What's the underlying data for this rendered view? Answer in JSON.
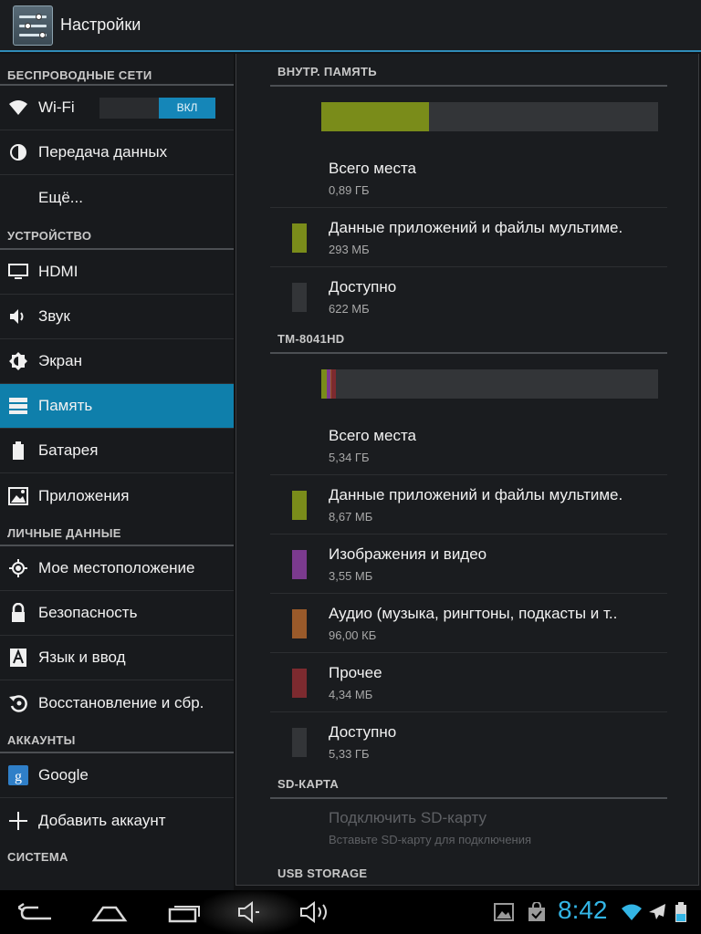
{
  "app": {
    "title": "Настройки"
  },
  "sidebar": {
    "sections": [
      {
        "header": "БЕСПРОВОДНЫЕ СЕТИ",
        "items": [
          {
            "label": "Wi-Fi",
            "icon": "wifi-icon",
            "toggle": "ВКЛ"
          },
          {
            "label": "Передача данных",
            "icon": "data-usage-icon"
          },
          {
            "label": "Ещё...",
            "icon": ""
          }
        ]
      },
      {
        "header": "УСТРОЙСТВО",
        "items": [
          {
            "label": "HDMI",
            "icon": "monitor-icon"
          },
          {
            "label": "Звук",
            "icon": "speaker-icon"
          },
          {
            "label": "Экран",
            "icon": "brightness-icon"
          },
          {
            "label": "Память",
            "icon": "storage-icon",
            "selected": true
          },
          {
            "label": "Батарея",
            "icon": "battery-icon"
          },
          {
            "label": "Приложения",
            "icon": "apps-icon"
          }
        ]
      },
      {
        "header": "ЛИЧНЫЕ ДАННЫЕ",
        "items": [
          {
            "label": "Мое местоположение",
            "icon": "location-icon"
          },
          {
            "label": "Безопасность",
            "icon": "lock-icon"
          },
          {
            "label": "Язык и ввод",
            "icon": "language-icon"
          },
          {
            "label": "Восстановление и сбр.",
            "icon": "restore-icon"
          }
        ]
      },
      {
        "header": "АККАУНТЫ",
        "items": [
          {
            "label": "Google",
            "icon": "google-icon"
          },
          {
            "label": "Добавить аккаунт",
            "icon": "add-icon"
          }
        ]
      },
      {
        "header": "СИСТЕМА",
        "items": []
      }
    ]
  },
  "storage": {
    "internal": {
      "header": "ВНУТР. ПАМЯТЬ",
      "usage_fraction": 0.32,
      "rows": [
        {
          "title": "Всего места",
          "sub": "0,89 ГБ",
          "color": ""
        },
        {
          "title": "Данные приложений и файлы мультиме.",
          "sub": "293 МБ",
          "color": "#7a8c1a"
        },
        {
          "title": "Доступно",
          "sub": "622 МБ",
          "color": "#333538"
        }
      ]
    },
    "device": {
      "header": "TM-8041HD",
      "segments": [
        {
          "color": "#7a8c1a",
          "fraction": 0.016
        },
        {
          "color": "#7b3a8e",
          "fraction": 0.011
        },
        {
          "color": "#9a5a2a",
          "fraction": 0.003
        },
        {
          "color": "#7d2a2f",
          "fraction": 0.014
        }
      ],
      "rows": [
        {
          "title": "Всего места",
          "sub": "5,34 ГБ",
          "color": ""
        },
        {
          "title": "Данные приложений и файлы мультиме.",
          "sub": "8,67 МБ",
          "color": "#7a8c1a"
        },
        {
          "title": "Изображения и видео",
          "sub": "3,55 МБ",
          "color": "#7b3a8e"
        },
        {
          "title": "Аудио (музыка, рингтоны, подкасты и т..",
          "sub": "96,00 КБ",
          "color": "#9a5a2a"
        },
        {
          "title": "Прочее",
          "sub": "4,34 МБ",
          "color": "#7d2a2f"
        },
        {
          "title": "Доступно",
          "sub": "5,33 ГБ",
          "color": "#333538"
        }
      ]
    },
    "sdcard": {
      "header": "SD-КАРТА",
      "rows": [
        {
          "title": "Подключить SD-карту",
          "sub": "Вставьте SD-карту для подключения"
        }
      ]
    },
    "usb": {
      "header": "USB STORAGE"
    }
  },
  "statusbar": {
    "time": "8:42",
    "accent": "#33b5e5"
  }
}
